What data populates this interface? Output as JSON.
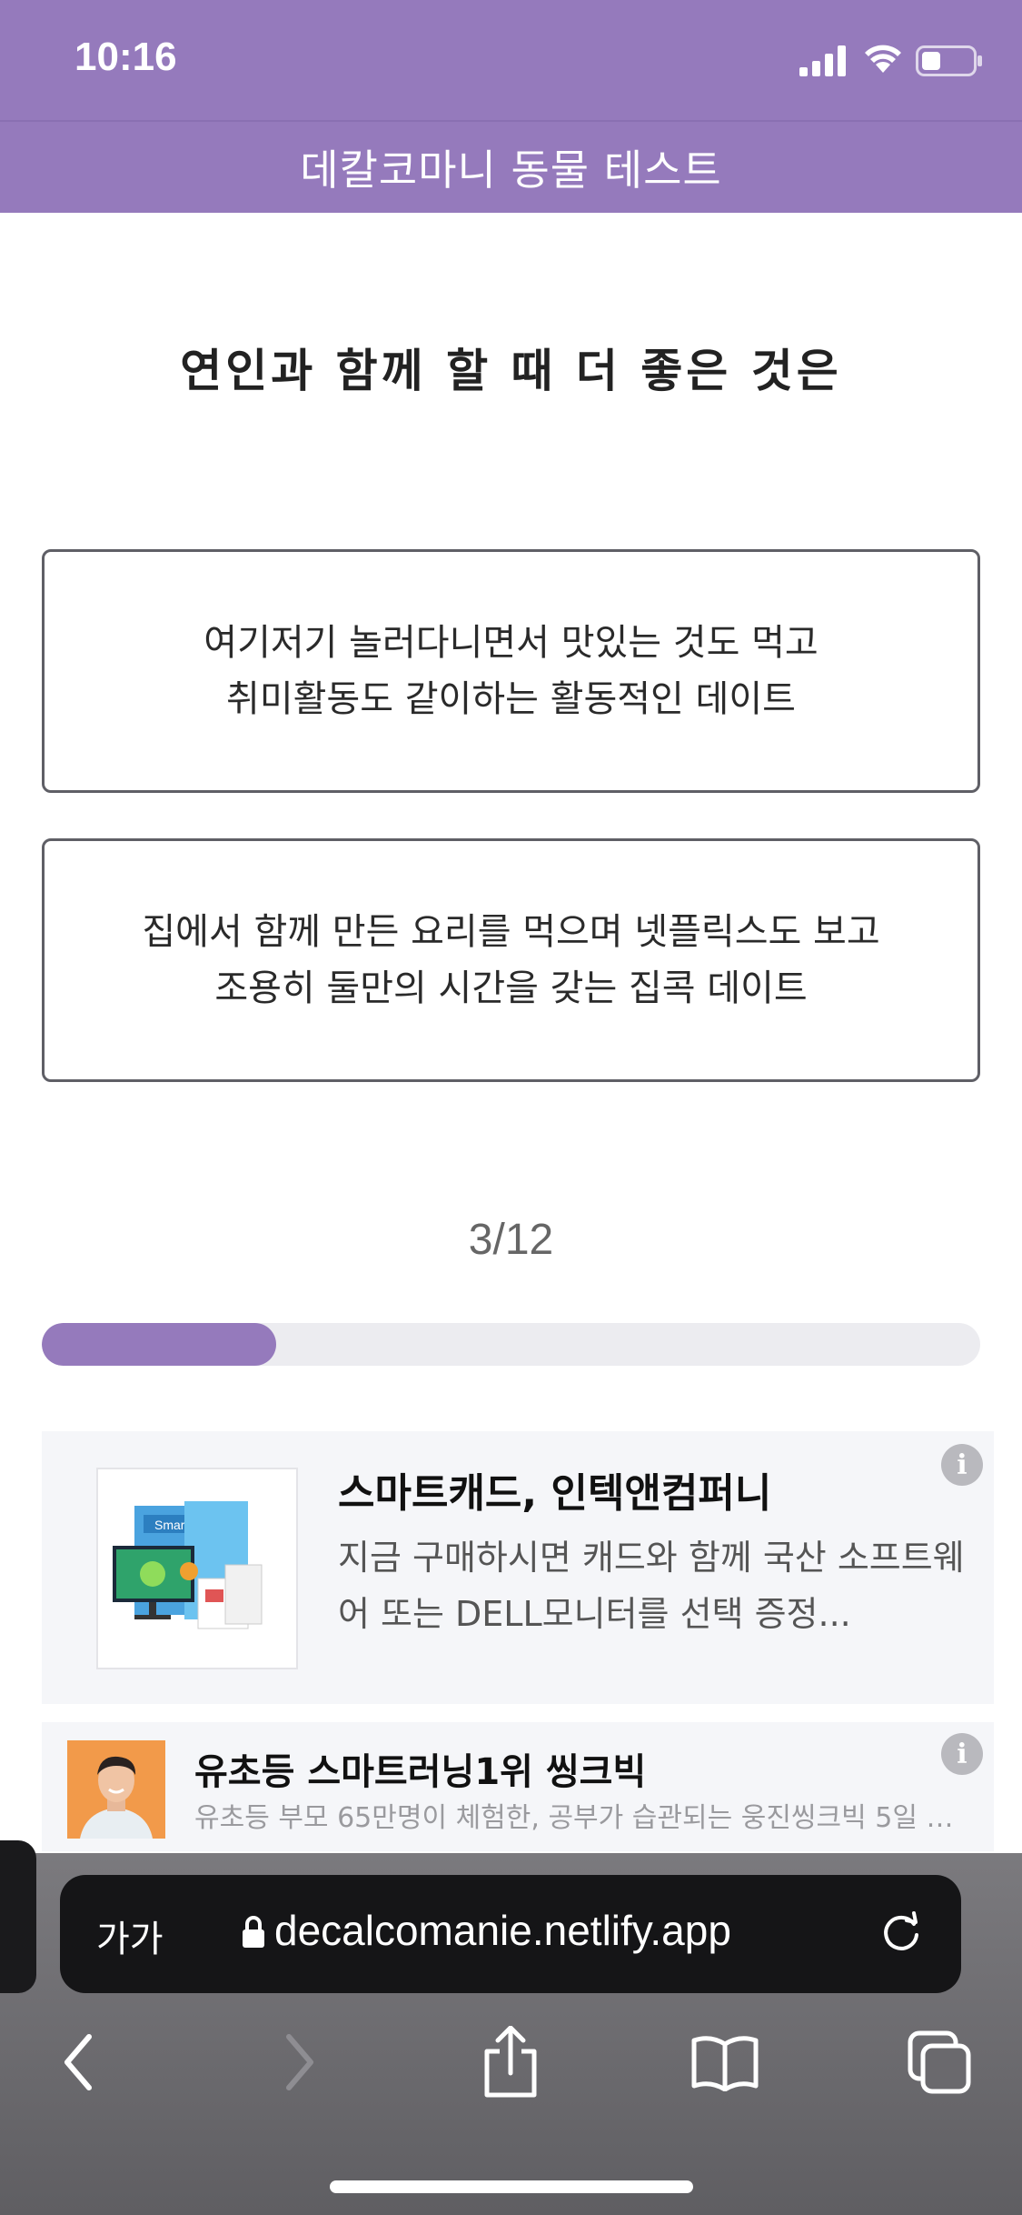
{
  "status_bar": {
    "time": "10:16"
  },
  "header": {
    "title": "데칼코마니 동물 테스트"
  },
  "question": {
    "text": "연인과 함께 할 때 더 좋은 것은"
  },
  "answers": [
    {
      "lines": [
        "여기저기 놀러다니면서 맛있는 것도 먹고",
        "취미활동도 같이하는 활동적인 데이트"
      ]
    },
    {
      "lines": [
        "집에서 함께 만든 요리를 먹으며 넷플릭스도 보고",
        "조용히 둘만의 시간을 갖는 집콕 데이트"
      ]
    }
  ],
  "progress": {
    "label": "3/12",
    "current": 3,
    "total": 12,
    "fill_fraction": 0.25
  },
  "ads": [
    {
      "title": "스마트캐드, 인텍앤컴퍼니",
      "description": "지금 구매하시면 캐드와 함께 국산 소프트웨어 또는 DELL모니터를 선택 증정...",
      "thumb_text": "Smart"
    },
    {
      "title": "유초등 스마트러닝1위 씽크빅",
      "description": "유초등 부모 65만명이 체험한, 공부가 습관되는 웅진씽크빅 5일 …"
    }
  ],
  "browser": {
    "text_size_label": "가가",
    "url": "decalcomanie.netlify.app"
  },
  "colors": {
    "accent": "#957abc",
    "track": "#ececf0"
  }
}
